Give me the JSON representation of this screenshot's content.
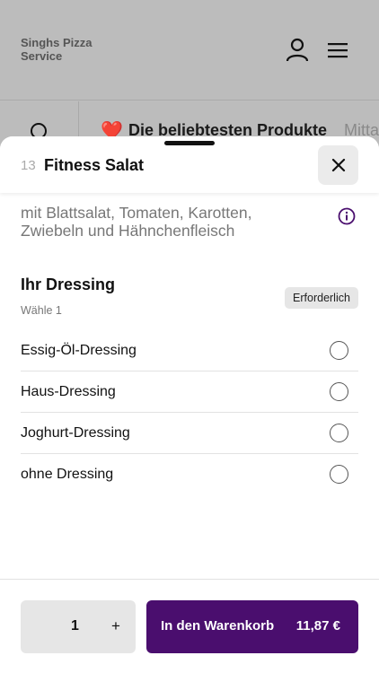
{
  "background": {
    "brand": "Singhs Pizza Service",
    "tabs": {
      "heart": "❤️",
      "popular": "Die beliebtesten Produkte",
      "next": "Mitta"
    }
  },
  "sheet": {
    "item_number": "13",
    "item_title": "Fitness Salat",
    "description": "mit Blattsalat, Tomaten, Karotten, Zwiebeln und Hähnchenfleisch",
    "dressing_section": {
      "title": "Ihr Dressing",
      "subtitle": "Wähle 1",
      "badge": "Erforderlich",
      "options": [
        {
          "label": "Essig-Öl-Dressing"
        },
        {
          "label": "Haus-Dressing"
        },
        {
          "label": "Joghurt-Dressing"
        },
        {
          "label": "ohne Dressing"
        }
      ]
    },
    "footer": {
      "quantity": "1",
      "plus_symbol": "+",
      "cart_label": "In den Warenkorb",
      "price": "11,87 €"
    }
  },
  "colors": {
    "accent": "#4a0e6e",
    "overlay": "#bcbcbc"
  },
  "icons": [
    "user-icon",
    "menu-icon",
    "search-icon",
    "close-icon",
    "info-icon"
  ]
}
